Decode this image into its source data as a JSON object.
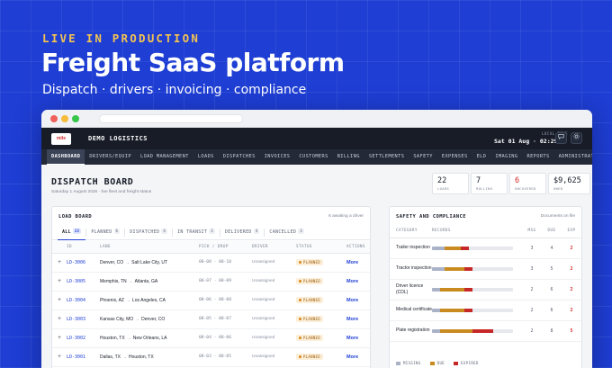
{
  "hero": {
    "tag": "LIVE IN PRODUCTION",
    "title": "Freight SaaS platform",
    "subtitle": "Dispatch · drivers · invoicing · compliance"
  },
  "app": {
    "logo_text": "mile",
    "company": "DEMO LOGISTICS",
    "local_time_label": "LOCAL TIME",
    "local_time_value": "Sat 01 Aug · 02:29",
    "nav": [
      "DASHBOARD",
      "DRIVERS/EQUIP",
      "LOAD MANAGEMENT",
      "LOADS",
      "DISPATCHES",
      "INVOICES",
      "CUSTOMERS",
      "BILLING",
      "SETTLEMENTS",
      "SAFETY",
      "EXPENSES",
      "ELD",
      "IMAGING",
      "REPORTS",
      "ADMINISTRATION"
    ],
    "nav_active": "DASHBOARD"
  },
  "page": {
    "title": "DISPATCH BOARD",
    "subtitle": "Saturday 1 August 2026 · live fleet and freight status"
  },
  "stats": [
    {
      "value": "22",
      "label": "LOADS"
    },
    {
      "value": "7",
      "label": "ROLLING"
    },
    {
      "value": "6",
      "label": "UNCOVERED"
    },
    {
      "value": "$9,625",
      "label": "OWED"
    }
  ],
  "load_board": {
    "title": "LOAD BOARD",
    "note": "6 awaiting a driver",
    "tabs": [
      {
        "label": "ALL",
        "count": "22"
      },
      {
        "label": "PLANNED",
        "count": "6"
      },
      {
        "label": "DISPATCHED",
        "count": "4"
      },
      {
        "label": "IN TRANSIT",
        "count": "3"
      },
      {
        "label": "DELIVERED",
        "count": "4"
      },
      {
        "label": "CANCELLED",
        "count": "3"
      }
    ],
    "columns": [
      "ID",
      "LANE",
      "PICK / DROP",
      "DRIVER",
      "STATUS",
      "ACTIONS"
    ],
    "rows": [
      {
        "id": "LD-3006",
        "from": "Denver, CO",
        "to": "Salt Lake City, UT",
        "pick": "08-08 · 08-10",
        "driver": "Unassigned",
        "status": "PLANNED",
        "action": "More"
      },
      {
        "id": "LD-3005",
        "from": "Memphis, TN",
        "to": "Atlanta, GA",
        "pick": "08-07 · 08-09",
        "driver": "Unassigned",
        "status": "PLANNED",
        "action": "More"
      },
      {
        "id": "LD-3004",
        "from": "Phoenix, AZ",
        "to": "Los Angeles, CA",
        "pick": "08-06 · 08-08",
        "driver": "Unassigned",
        "status": "PLANNED",
        "action": "More"
      },
      {
        "id": "LD-3003",
        "from": "Kansas City, MO",
        "to": "Denver, CO",
        "pick": "08-05 · 08-07",
        "driver": "Unassigned",
        "status": "PLANNED",
        "action": "More"
      },
      {
        "id": "LD-3002",
        "from": "Houston, TX",
        "to": "New Orleans, LA",
        "pick": "08-04 · 08-06",
        "driver": "Unassigned",
        "status": "PLANNED",
        "action": "More"
      },
      {
        "id": "LD-3001",
        "from": "Dallas, TX",
        "to": "Houston, TX",
        "pick": "08-03 · 08-05",
        "driver": "Unassigned",
        "status": "PLANNED",
        "action": "More"
      }
    ]
  },
  "safety": {
    "title": "SAFETY AND COMPLIANCE",
    "note": "Documents on file",
    "columns": [
      "CATEGORY",
      "RECORDS",
      "MSG",
      "DUE",
      "EXP"
    ],
    "rows": [
      {
        "category": "Trailer inspection",
        "missing": 3,
        "due": 4,
        "expired": 2
      },
      {
        "category": "Tractor inspection",
        "missing": 3,
        "due": 5,
        "expired": 2
      },
      {
        "category": "Driver licence (CDL)",
        "missing": 2,
        "due": 6,
        "expired": 2
      },
      {
        "category": "Medical certificate",
        "missing": 2,
        "due": 6,
        "expired": 2
      },
      {
        "category": "Plate registration",
        "missing": 2,
        "due": 8,
        "expired": 5
      }
    ],
    "legend": [
      {
        "label": "MISSING",
        "color": "#aab2c8"
      },
      {
        "label": "DUE",
        "color": "#c98b1f"
      },
      {
        "label": "EXPIRED",
        "color": "#c62828"
      }
    ],
    "scale_max": 20
  }
}
